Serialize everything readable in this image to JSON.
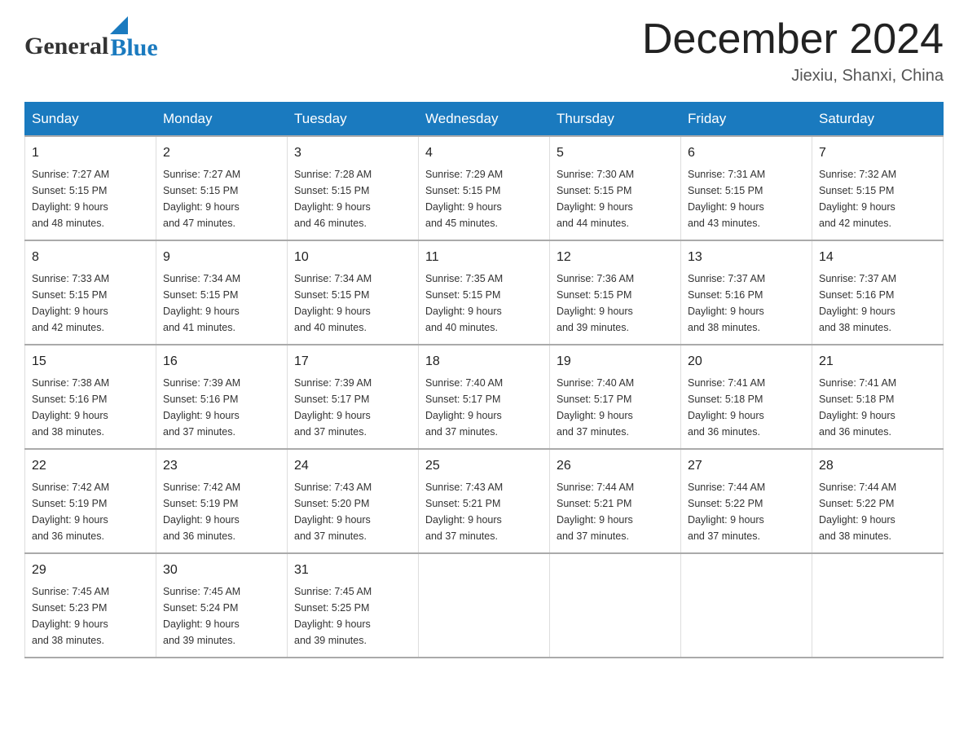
{
  "header": {
    "logo_general": "General",
    "logo_blue": "Blue",
    "title": "December 2024",
    "location": "Jiexiu, Shanxi, China"
  },
  "days_of_week": [
    "Sunday",
    "Monday",
    "Tuesday",
    "Wednesday",
    "Thursday",
    "Friday",
    "Saturday"
  ],
  "weeks": [
    [
      {
        "day": "1",
        "sunrise": "7:27 AM",
        "sunset": "5:15 PM",
        "daylight": "9 hours and 48 minutes."
      },
      {
        "day": "2",
        "sunrise": "7:27 AM",
        "sunset": "5:15 PM",
        "daylight": "9 hours and 47 minutes."
      },
      {
        "day": "3",
        "sunrise": "7:28 AM",
        "sunset": "5:15 PM",
        "daylight": "9 hours and 46 minutes."
      },
      {
        "day": "4",
        "sunrise": "7:29 AM",
        "sunset": "5:15 PM",
        "daylight": "9 hours and 45 minutes."
      },
      {
        "day": "5",
        "sunrise": "7:30 AM",
        "sunset": "5:15 PM",
        "daylight": "9 hours and 44 minutes."
      },
      {
        "day": "6",
        "sunrise": "7:31 AM",
        "sunset": "5:15 PM",
        "daylight": "9 hours and 43 minutes."
      },
      {
        "day": "7",
        "sunrise": "7:32 AM",
        "sunset": "5:15 PM",
        "daylight": "9 hours and 42 minutes."
      }
    ],
    [
      {
        "day": "8",
        "sunrise": "7:33 AM",
        "sunset": "5:15 PM",
        "daylight": "9 hours and 42 minutes."
      },
      {
        "day": "9",
        "sunrise": "7:34 AM",
        "sunset": "5:15 PM",
        "daylight": "9 hours and 41 minutes."
      },
      {
        "day": "10",
        "sunrise": "7:34 AM",
        "sunset": "5:15 PM",
        "daylight": "9 hours and 40 minutes."
      },
      {
        "day": "11",
        "sunrise": "7:35 AM",
        "sunset": "5:15 PM",
        "daylight": "9 hours and 40 minutes."
      },
      {
        "day": "12",
        "sunrise": "7:36 AM",
        "sunset": "5:15 PM",
        "daylight": "9 hours and 39 minutes."
      },
      {
        "day": "13",
        "sunrise": "7:37 AM",
        "sunset": "5:16 PM",
        "daylight": "9 hours and 38 minutes."
      },
      {
        "day": "14",
        "sunrise": "7:37 AM",
        "sunset": "5:16 PM",
        "daylight": "9 hours and 38 minutes."
      }
    ],
    [
      {
        "day": "15",
        "sunrise": "7:38 AM",
        "sunset": "5:16 PM",
        "daylight": "9 hours and 38 minutes."
      },
      {
        "day": "16",
        "sunrise": "7:39 AM",
        "sunset": "5:16 PM",
        "daylight": "9 hours and 37 minutes."
      },
      {
        "day": "17",
        "sunrise": "7:39 AM",
        "sunset": "5:17 PM",
        "daylight": "9 hours and 37 minutes."
      },
      {
        "day": "18",
        "sunrise": "7:40 AM",
        "sunset": "5:17 PM",
        "daylight": "9 hours and 37 minutes."
      },
      {
        "day": "19",
        "sunrise": "7:40 AM",
        "sunset": "5:17 PM",
        "daylight": "9 hours and 37 minutes."
      },
      {
        "day": "20",
        "sunrise": "7:41 AM",
        "sunset": "5:18 PM",
        "daylight": "9 hours and 36 minutes."
      },
      {
        "day": "21",
        "sunrise": "7:41 AM",
        "sunset": "5:18 PM",
        "daylight": "9 hours and 36 minutes."
      }
    ],
    [
      {
        "day": "22",
        "sunrise": "7:42 AM",
        "sunset": "5:19 PM",
        "daylight": "9 hours and 36 minutes."
      },
      {
        "day": "23",
        "sunrise": "7:42 AM",
        "sunset": "5:19 PM",
        "daylight": "9 hours and 36 minutes."
      },
      {
        "day": "24",
        "sunrise": "7:43 AM",
        "sunset": "5:20 PM",
        "daylight": "9 hours and 37 minutes."
      },
      {
        "day": "25",
        "sunrise": "7:43 AM",
        "sunset": "5:21 PM",
        "daylight": "9 hours and 37 minutes."
      },
      {
        "day": "26",
        "sunrise": "7:44 AM",
        "sunset": "5:21 PM",
        "daylight": "9 hours and 37 minutes."
      },
      {
        "day": "27",
        "sunrise": "7:44 AM",
        "sunset": "5:22 PM",
        "daylight": "9 hours and 37 minutes."
      },
      {
        "day": "28",
        "sunrise": "7:44 AM",
        "sunset": "5:22 PM",
        "daylight": "9 hours and 38 minutes."
      }
    ],
    [
      {
        "day": "29",
        "sunrise": "7:45 AM",
        "sunset": "5:23 PM",
        "daylight": "9 hours and 38 minutes."
      },
      {
        "day": "30",
        "sunrise": "7:45 AM",
        "sunset": "5:24 PM",
        "daylight": "9 hours and 39 minutes."
      },
      {
        "day": "31",
        "sunrise": "7:45 AM",
        "sunset": "5:25 PM",
        "daylight": "9 hours and 39 minutes."
      },
      null,
      null,
      null,
      null
    ]
  ],
  "labels": {
    "sunrise_prefix": "Sunrise: ",
    "sunset_prefix": "Sunset: ",
    "daylight_prefix": "Daylight: "
  }
}
